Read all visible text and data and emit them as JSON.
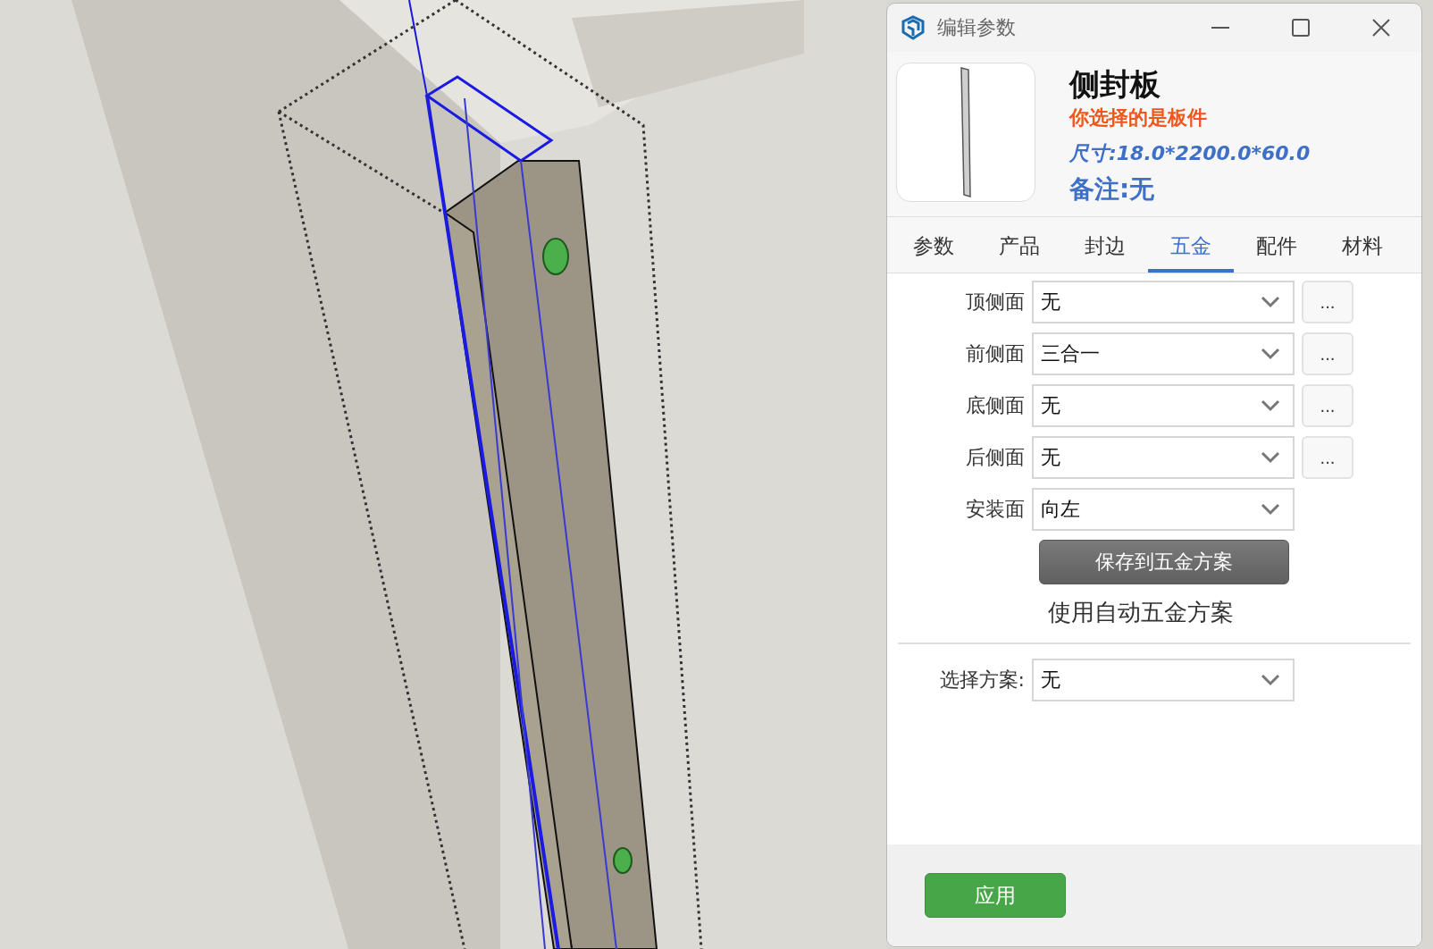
{
  "window": {
    "title": "编辑参数"
  },
  "part": {
    "name": "侧封板",
    "subtitle": "你选择的是板件",
    "size": "尺寸:18.0*2200.0*60.0",
    "note": "备注:无"
  },
  "tabs": [
    {
      "label": "参数",
      "selected": false
    },
    {
      "label": "产品",
      "selected": false
    },
    {
      "label": "封边",
      "selected": false
    },
    {
      "label": "五金",
      "selected": true
    },
    {
      "label": "配件",
      "selected": false
    },
    {
      "label": "材料",
      "selected": false
    }
  ],
  "fields": [
    {
      "label": "顶侧面",
      "value": "无",
      "more": "..."
    },
    {
      "label": "前侧面",
      "value": "三合一",
      "more": "..."
    },
    {
      "label": "底侧面",
      "value": "无",
      "more": "..."
    },
    {
      "label": "后侧面",
      "value": "无",
      "more": "..."
    },
    {
      "label": "安装面",
      "value": "向左"
    }
  ],
  "save_button": "保存到五金方案",
  "auto_scheme_link": "使用自动五金方案",
  "scheme": {
    "label": "选择方案:",
    "value": "无"
  },
  "apply_button": "应用"
}
